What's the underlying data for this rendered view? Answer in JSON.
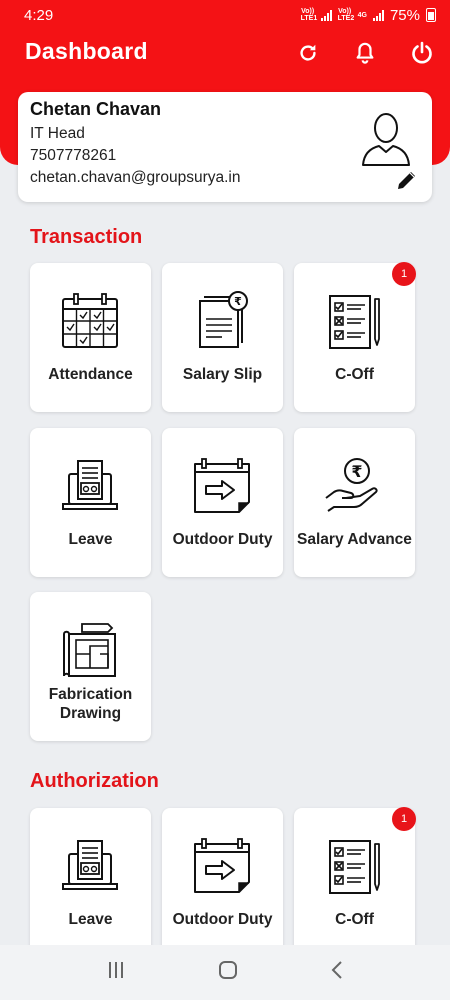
{
  "status_bar": {
    "time": "4:29",
    "sim1": "Vo)) LTE1",
    "sim2": "Vo)) LTE2",
    "network": "4G",
    "battery": "75%"
  },
  "header": {
    "title": "Dashboard",
    "actions": [
      "refresh-icon",
      "bell-icon",
      "power-icon"
    ]
  },
  "profile": {
    "name": "Chetan Chavan",
    "role": "IT Head",
    "phone": "7507778261",
    "email": "chetan.chavan@groupsurya.in"
  },
  "transaction": {
    "title": "Transaction",
    "tiles": [
      {
        "label": "Attendance",
        "icon": "calendar-icon"
      },
      {
        "label": "Salary Slip",
        "icon": "salary-slip-icon"
      },
      {
        "label": "C-Off",
        "icon": "checklist-icon",
        "badge": "1"
      },
      {
        "label": "Leave",
        "icon": "laptop-document-icon"
      },
      {
        "label": "Outdoor Duty",
        "icon": "calendar-arrow-icon"
      },
      {
        "label": "Salary Advance",
        "icon": "rupee-hand-icon"
      },
      {
        "label": "Fabrication Drawing",
        "icon": "blueprint-icon"
      }
    ]
  },
  "authorization": {
    "title": "Authorization",
    "tiles": [
      {
        "label": "Leave",
        "icon": "laptop-document-icon"
      },
      {
        "label": "Outdoor Duty",
        "icon": "calendar-arrow-icon"
      },
      {
        "label": "C-Off",
        "icon": "checklist-icon",
        "badge": "1"
      }
    ]
  },
  "nav_bar": {
    "buttons": [
      "recent-apps-icon",
      "home-icon",
      "back-icon"
    ]
  }
}
